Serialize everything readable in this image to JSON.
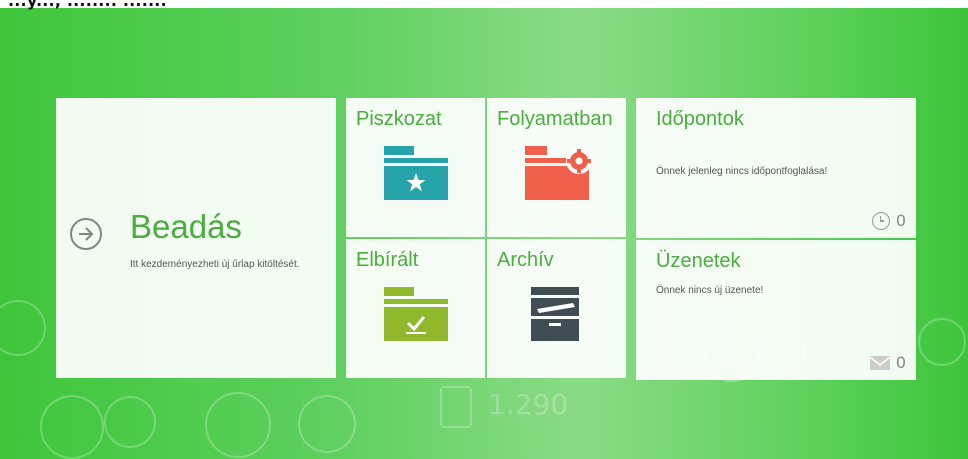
{
  "top_text": "...y..., ........ .......",
  "beadas": {
    "title": "Beadás",
    "subtitle": "Itt kezdeményezheti új űrlap kitöltését."
  },
  "piszkozat": {
    "title": "Piszkozat"
  },
  "folyamatban": {
    "title": "Folyamatban"
  },
  "elbiralt": {
    "title": "Elbírált"
  },
  "archiv": {
    "title": "Archív"
  },
  "idopontok": {
    "title": "Időpontok",
    "message": "Önnek jelenleg nincs időpontfoglalása!",
    "count": "0"
  },
  "uzenetek": {
    "title": "Üzenetek",
    "message": "Önnek nincs új üzenete!",
    "count": "0"
  },
  "bg_counter": "1.290",
  "colors": {
    "green": "#4aad3e",
    "teal": "#26a4a9",
    "coral": "#f0604b",
    "lime": "#8fb82a",
    "dark": "#414d55"
  }
}
